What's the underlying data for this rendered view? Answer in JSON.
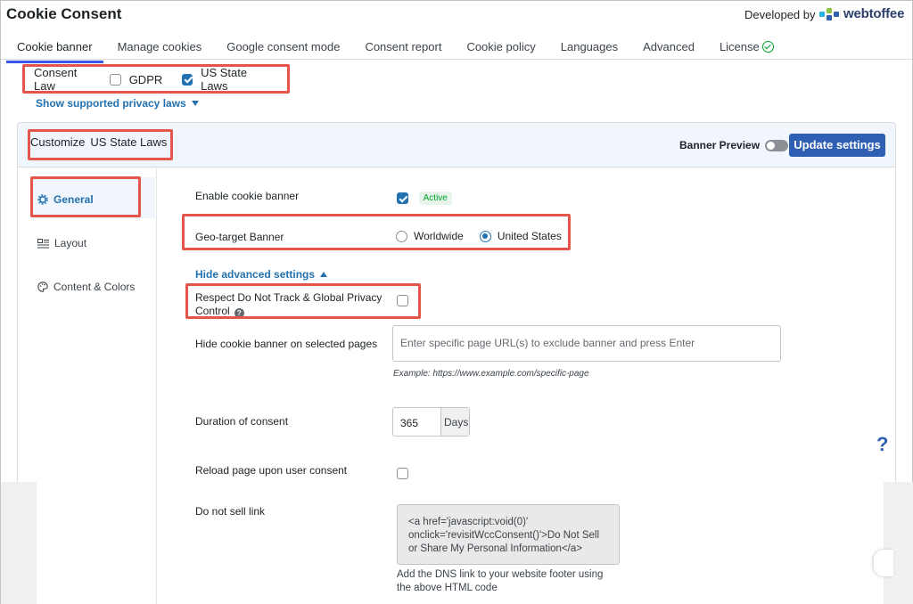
{
  "app": {
    "title": "Cookie Consent",
    "developed_by": "Developed by",
    "brand_name": "webtoffee"
  },
  "tabs": [
    {
      "label": "Cookie banner",
      "active": true
    },
    {
      "label": "Manage cookies",
      "active": false
    },
    {
      "label": "Google consent mode",
      "active": false
    },
    {
      "label": "Consent report",
      "active": false
    },
    {
      "label": "Cookie policy",
      "active": false
    },
    {
      "label": "Languages",
      "active": false
    },
    {
      "label": "Advanced",
      "active": false
    },
    {
      "label": "License",
      "active": false
    }
  ],
  "consent_law": {
    "label": "Consent Law",
    "options": [
      {
        "label": "GDPR",
        "checked": false
      },
      {
        "label": "US State Laws",
        "checked": true
      }
    ],
    "show_laws_link": "Show supported privacy laws"
  },
  "customize": {
    "label": "Customize",
    "law": "US State Laws",
    "banner_preview_label": "Banner Preview",
    "banner_preview_on": false,
    "update_button": "Update settings"
  },
  "sidebar": {
    "items": [
      {
        "label": "General",
        "icon": "gear-icon",
        "active": true
      },
      {
        "label": "Layout",
        "icon": "layout-icon",
        "active": false
      },
      {
        "label": "Content & Colors",
        "icon": "palette-icon",
        "active": false
      }
    ]
  },
  "settings": {
    "enable_banner": {
      "label": "Enable cookie banner",
      "checked": true,
      "badge": "Active"
    },
    "geo_target": {
      "label": "Geo-target Banner",
      "options": [
        {
          "label": "Worldwide",
          "selected": false
        },
        {
          "label": "United States",
          "selected": true
        }
      ]
    },
    "hide_advanced_link": "Hide advanced settings",
    "dnt": {
      "label_line1": "Respect Do Not Track & Global Privacy",
      "label_line2": "Control",
      "checked": false
    },
    "hide_pages": {
      "label": "Hide cookie banner on selected pages",
      "placeholder": "Enter specific page URL(s) to exclude banner and press Enter",
      "example": "Example: https://www.example.com/specific-page"
    },
    "duration": {
      "label": "Duration of consent",
      "value": "365",
      "unit": "Days"
    },
    "reload": {
      "label": "Reload page upon user consent",
      "checked": false
    },
    "dns_link": {
      "label": "Do not sell link",
      "code_line1": "<a href='javascript:void(0)'",
      "code_line2": "onclick='revisitWccConsent()'>Do Not Sell",
      "code_line3": "or Share My Personal Information</a>",
      "note_line1": "Add the DNS link to your website footer using",
      "note_line2": "the above HTML code"
    }
  },
  "colors": {
    "accent": "#2271b1",
    "button": "#2f5fb3",
    "highlight": "#e4564c",
    "active_badge": "#00a32a"
  },
  "floating_help": "?"
}
